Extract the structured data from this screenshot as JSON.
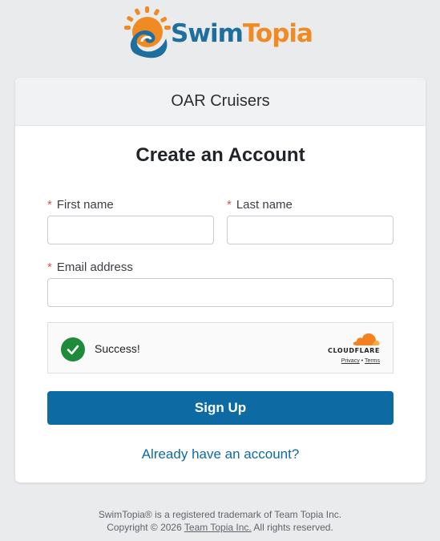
{
  "brand": {
    "swim": "Swim",
    "topia": "Topia",
    "orange": "#f08a23",
    "blue": "#1e6f9e"
  },
  "org_name": "OAR Cruisers",
  "form": {
    "title": "Create an Account",
    "required_marker": "*",
    "first_name_label": "First name",
    "first_name_value": "",
    "last_name_label": "Last name",
    "last_name_value": "",
    "email_label": "Email address",
    "email_value": ""
  },
  "captcha": {
    "status": "Success!",
    "provider": "CLOUDFLARE",
    "privacy": "Privacy",
    "separator": "•",
    "terms": "Terms",
    "success_color": "#1e8a3a"
  },
  "actions": {
    "signup_label": "Sign Up",
    "login_link": "Already have an account?",
    "accent": "#0e6aa3"
  },
  "footer": {
    "line1": "SwimTopia® is a registered trademark of Team Topia Inc.",
    "line2_prefix": "Copyright © 2026 ",
    "line2_link": "Team Topia Inc.",
    "line2_suffix": " All rights reserved."
  }
}
